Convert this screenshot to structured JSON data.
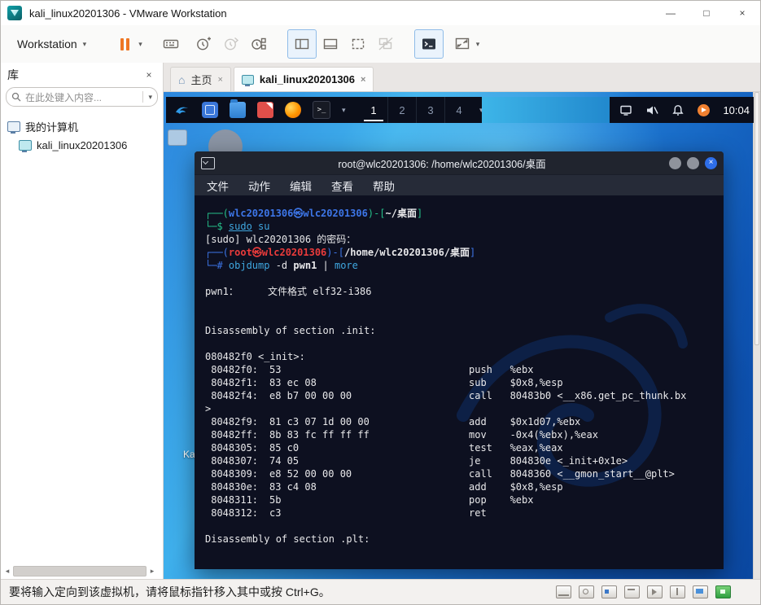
{
  "window": {
    "title": "kali_linux20201306 - VMware Workstation",
    "minimize": "—",
    "maximize": "□",
    "close": "×"
  },
  "icons": {
    "caret": "▾",
    "close": "×",
    "home": "⌂",
    "scroll_left": "◂",
    "scroll_right": "▸"
  },
  "toolbar": {
    "workstation": "Workstation"
  },
  "sidebar": {
    "title": "库",
    "search_placeholder": "在此处键入内容...",
    "my_computer": "我的计算机",
    "vm_name": "kali_linux20201306"
  },
  "tabs": {
    "home": "主页",
    "vm": "kali_linux20201306"
  },
  "kali_panel": {
    "workspaces": [
      "1",
      "2",
      "3",
      "4"
    ],
    "clock": "10:04"
  },
  "desktop": {
    "label_fragment": "Ka"
  },
  "terminal": {
    "title": "root@wlc20201306: /home/wlc20201306/桌面",
    "menu": [
      "文件",
      "动作",
      "编辑",
      "查看",
      "帮助"
    ],
    "prompt1": {
      "open": "┌──(",
      "user": "wlc20201306㉿wlc20201306",
      "mid": ")-[",
      "path": "~/桌面",
      "close": "]"
    },
    "cmd1": {
      "frame": "└─$ ",
      "sudo": "sudo",
      "rest": " su"
    },
    "password_prompt": "[sudo] wlc20201306 的密码：",
    "prompt2": {
      "open": "┌──(",
      "user": "root㉿wlc20201306",
      "mid": ")-[",
      "path": "/home/wlc20201306/桌面",
      "close": "]"
    },
    "cmd2": {
      "frame": "└─# ",
      "cmd": "objdump",
      "opt": " -d ",
      "file": "pwn1",
      "pipe": " | ",
      "pager": "more"
    },
    "file_info": "pwn1：     文件格式 elf32-i386",
    "section_init": "Disassembly of section .init:",
    "init_label": "080482f0 <_init>:",
    "wrap_line": ">",
    "disasm": [
      {
        "addr": " 80482f0:",
        "bytes": "53",
        "asm": "push   %ebx"
      },
      {
        "addr": " 80482f1:",
        "bytes": "83 ec 08",
        "asm": "sub    $0x8,%esp"
      },
      {
        "addr": " 80482f4:",
        "bytes": "e8 b7 00 00 00",
        "asm": "call   80483b0 <__x86.get_pc_thunk.bx"
      },
      {
        "addr": " 80482f9:",
        "bytes": "81 c3 07 1d 00 00",
        "asm": "add    $0x1d07,%ebx"
      },
      {
        "addr": " 80482ff:",
        "bytes": "8b 83 fc ff ff ff",
        "asm": "mov    -0x4(%ebx),%eax"
      },
      {
        "addr": " 8048305:",
        "bytes": "85 c0",
        "asm": "test   %eax,%eax"
      },
      {
        "addr": " 8048307:",
        "bytes": "74 05",
        "asm": "je     804830e <_init+0x1e>"
      },
      {
        "addr": " 8048309:",
        "bytes": "e8 52 00 00 00",
        "asm": "call   8048360 <__gmon_start__@plt>"
      },
      {
        "addr": " 804830e:",
        "bytes": "83 c4 08",
        "asm": "add    $0x8,%esp"
      },
      {
        "addr": " 8048311:",
        "bytes": "5b",
        "asm": "pop    %ebx"
      },
      {
        "addr": " 8048312:",
        "bytes": "c3",
        "asm": "ret"
      }
    ],
    "section_plt": "Disassembly of section .plt:"
  },
  "status_bar": {
    "message": "要将输入定向到该虚拟机，请将鼠标指针移入其中或按 Ctrl+G。"
  },
  "status_icons": [
    "hard-disk",
    "cdrom",
    "network-adapter",
    "printer",
    "sound",
    "usb",
    "display",
    "vmware-tools"
  ]
}
